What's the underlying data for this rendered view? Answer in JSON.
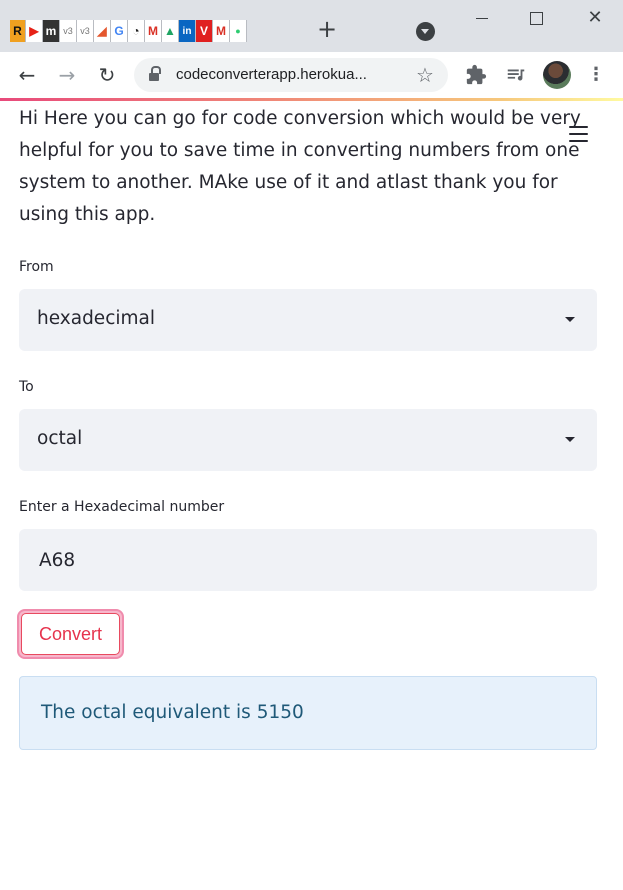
{
  "browser": {
    "tab_favicons": [
      "R",
      "▶",
      "m",
      "v3",
      "v3",
      "◢",
      "G",
      "◔",
      "M",
      "▲",
      "in",
      "V",
      "M",
      "●"
    ],
    "new_tab_glyph": "+",
    "url": "codeconverterapp.herokua...",
    "icons": {
      "back": "arrow-left-icon",
      "forward": "arrow-right-icon",
      "reload": "reload-icon",
      "lock": "lock-icon",
      "star": "star-icon",
      "extensions": "puzzle-icon",
      "media": "media-queue-icon",
      "menu": "kebab-menu-icon",
      "tab_search": "tab-search-icon"
    }
  },
  "page": {
    "intro": "Hi Here you can go for code conversion which would be very helpful for you to save time in converting numbers from one system to another. MAke use of it and atlast thank you for using this app.",
    "from": {
      "label": "From",
      "value": "hexadecimal"
    },
    "to": {
      "label": "To",
      "value": "octal"
    },
    "number_input": {
      "label": "Enter a Hexadecimal number",
      "value": "A68"
    },
    "convert_label": "Convert",
    "result": "The octal equivalent is 5150"
  },
  "colors": {
    "accent": "#e6334d",
    "info_bg": "#e7f1fb",
    "info_text": "#1f5978",
    "input_bg": "#f0f2f6"
  }
}
